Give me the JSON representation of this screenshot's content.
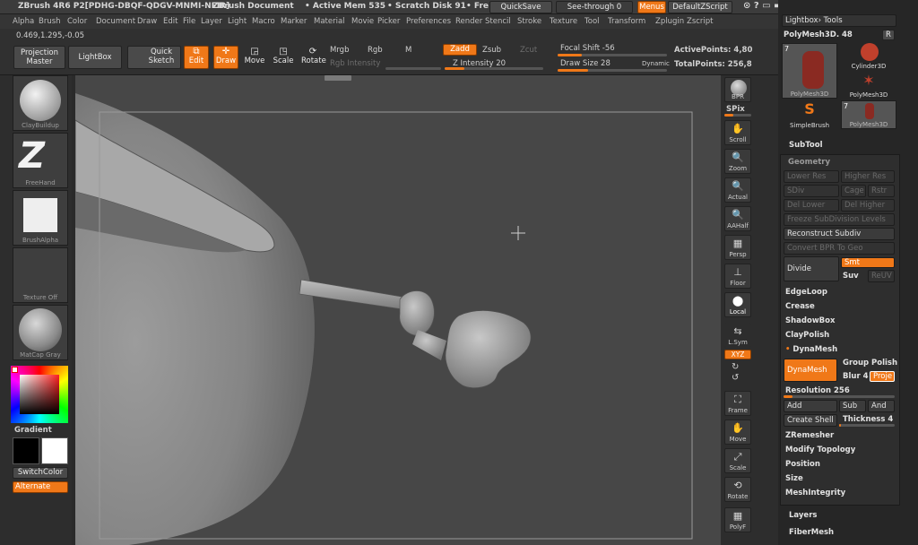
{
  "titlebar": {
    "app": "ZBrush 4R6 P2[PDHG-DBQF-QDGV-MNMI-NEIR]",
    "doc": "ZBrush Document",
    "mem": "• Active Mem 535",
    "scratch": "• Scratch Disk 91",
    "fr": "• Fre",
    "quicksave": "QuickSave",
    "seethrough": "See-through  0",
    "menus": "Menus",
    "zscript": "DefaultZScript"
  },
  "menu": [
    "Alpha",
    "Brush",
    "Color",
    "Document",
    "Draw",
    "Edit",
    "File",
    "Layer",
    "Light",
    "Macro",
    "Marker",
    "Material",
    "Movie",
    "Picker",
    "Preferences",
    "Render",
    "Stencil",
    "Stroke",
    "Texture",
    "Tool",
    "Transform",
    "Zplugin",
    "Zscript"
  ],
  "shelf": {
    "coords": "0.469,1.295,-0.05",
    "projection_master": "Projection Master",
    "lightbox": "LightBox",
    "quick_sketch": "Quick Sketch",
    "edit": "Edit",
    "draw": "Draw",
    "move": "Move",
    "scale": "Scale",
    "rotate": "Rotate",
    "mrgb": "Mrgb",
    "rgb": "Rgb",
    "m": "M",
    "rgb_intensity": "Rgb Intensity",
    "zadd": "Zadd",
    "zsub": "Zsub",
    "zcut": "Zcut",
    "z_intensity": "Z Intensity 20",
    "focal_shift": "Focal Shift -56",
    "draw_size": "Draw Size 28",
    "dynamic": "Dynamic",
    "active_points": "ActivePoints: 4,80",
    "total_points": "TotalPoints: 256,8"
  },
  "left": {
    "brush": "ClayBuildup",
    "stroke": "FreeHand",
    "alpha": "BrushAlpha",
    "texture": "Texture Off",
    "material": "MatCap Gray",
    "gradient": "Gradient",
    "switchcolor": "SwitchColor",
    "alternate": "Alternate"
  },
  "right": {
    "bpr": "BPR",
    "spix": "SPix",
    "scroll": "Scroll",
    "zoom": "Zoom",
    "actual": "Actual",
    "aahalf": "AAHalf",
    "persp": "Persp",
    "floor": "Floor",
    "local": "Local",
    "lsym": "L.Sym",
    "xyz": "XYZ",
    "frame": "Frame",
    "move": "Move",
    "scale": "Scale",
    "rotate": "Rotate",
    "polyf": "PolyF"
  },
  "tool": {
    "header": "Lightbox› Tools",
    "current": "PolyMesh3D. 48",
    "r": "R",
    "num": "7",
    "thumbs": [
      "PolyMesh3D",
      "Cylinder3D",
      "PolyMesh3D",
      "SimpleBrush",
      "PolyMesh3D"
    ],
    "subtool": "SubTool",
    "geometry": "Geometry",
    "lower_res": "Lower Res",
    "higher_res": "Higher Res",
    "sdiv": "SDiv",
    "cage": "Cage",
    "rstr": "Rstr",
    "del_lower": "Del Lower",
    "del_higher": "Del Higher",
    "freeze": "Freeze SubDivision Levels",
    "reconstruct": "Reconstruct Subdiv",
    "convert_bpr": "Convert BPR To Geo",
    "divide": "Divide",
    "smt": "Smt",
    "suv": "Suv",
    "reuv": "ReUV",
    "edgeloop": "EdgeLoop",
    "crease": "Crease",
    "shadowbox": "ShadowBox",
    "claypolish": "ClayPolish",
    "dynamesh_label": "DynaMesh",
    "dynamesh_btn": "DynaMesh",
    "group": "Group",
    "polish": "Polish",
    "blur": "Blur 4",
    "project": "Proje",
    "resolution": "Resolution 256",
    "add": "Add",
    "sub": "Sub",
    "and": "And",
    "create_shell": "Create Shell",
    "thickness": "Thickness 4",
    "zremesher": "ZRemesher",
    "modify_topology": "Modify Topology",
    "position": "Position",
    "size": "Size",
    "meshintegrity": "MeshIntegrity",
    "layers": "Layers",
    "fibermesh": "FiberMesh"
  },
  "sliders": {
    "z_intensity": 0.2,
    "rgb_intensity": 0.0,
    "focal_shift": 0.22,
    "draw_size": 0.28,
    "resolution": 0.08,
    "thickness": 0.04
  },
  "colors": {
    "accent": "#f07818",
    "panel": "#262626",
    "viewport": "#474747"
  }
}
